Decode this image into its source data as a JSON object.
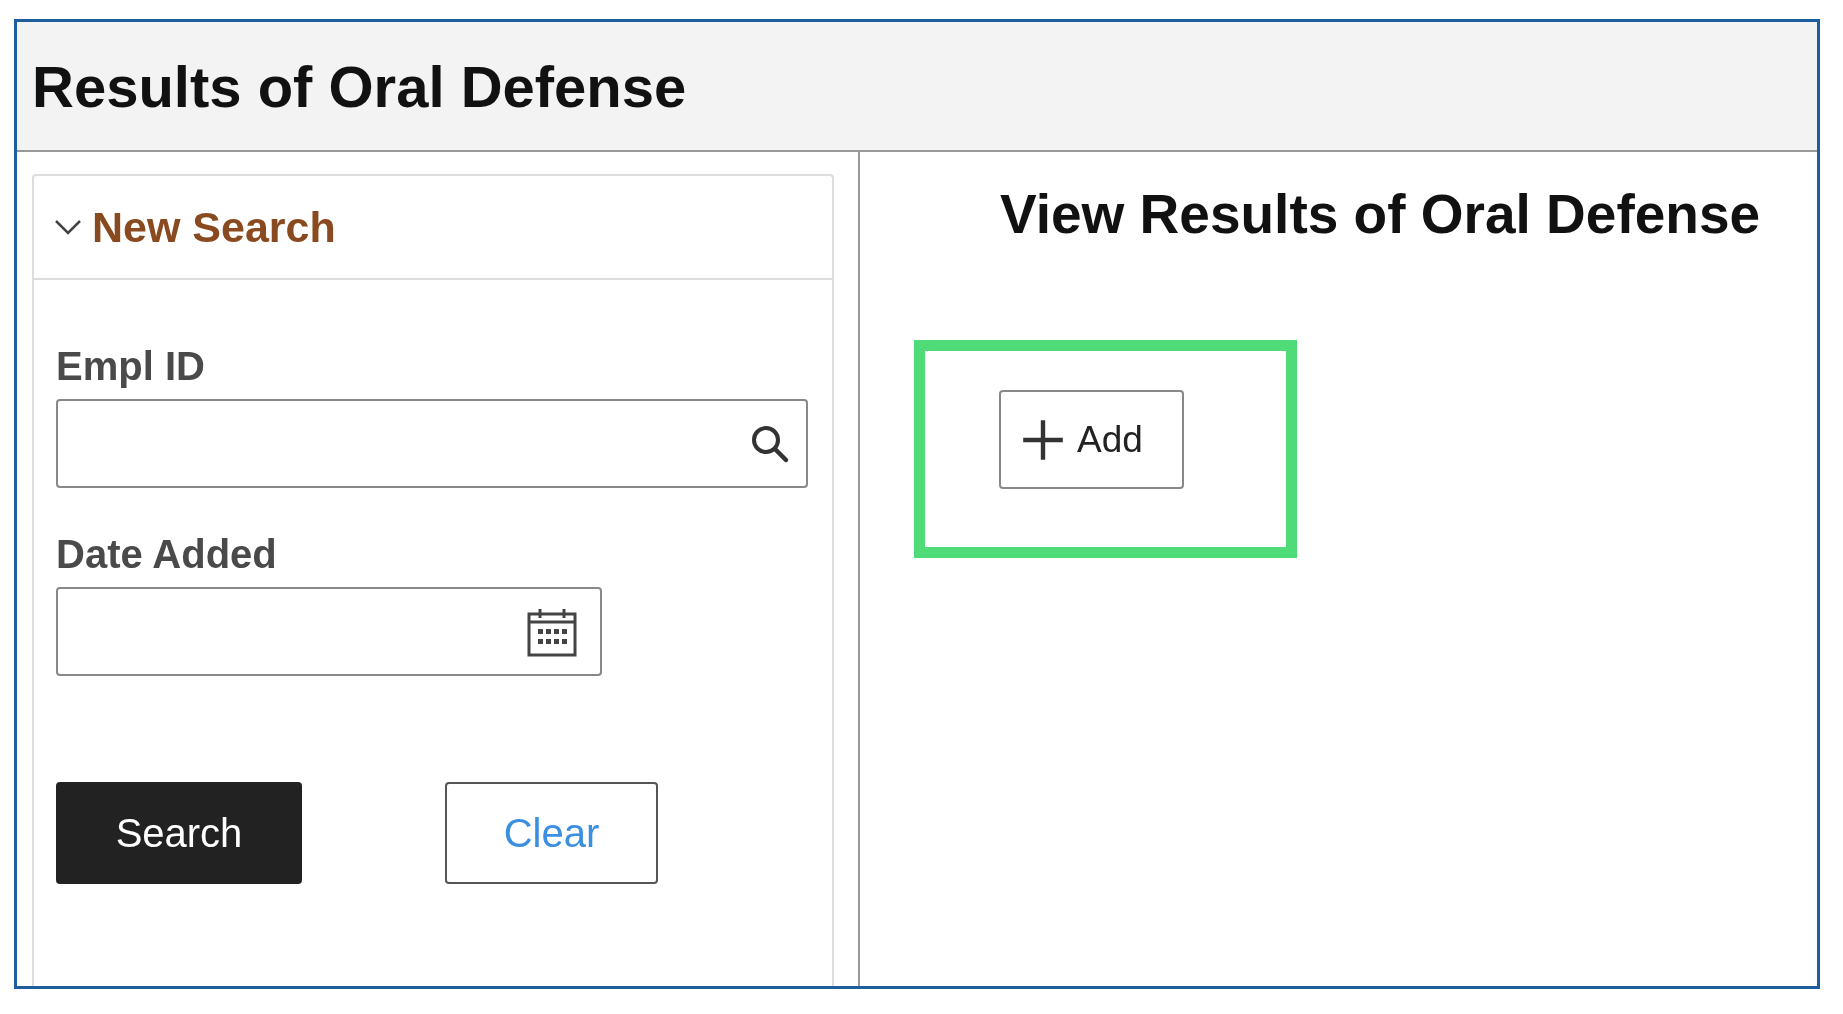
{
  "page": {
    "title": "Results of Oral Defense"
  },
  "search_panel": {
    "heading": "New Search",
    "expanded": true,
    "fields": [
      {
        "label": "Empl ID",
        "kind": "lookup"
      },
      {
        "label": "Date Added",
        "kind": "date"
      }
    ],
    "buttons": [
      {
        "label": "Search",
        "kind": "primary"
      },
      {
        "label": "Clear",
        "kind": "secondary"
      }
    ]
  },
  "main": {
    "title": "View Results of Oral Defense",
    "add_button": {
      "label": "Add",
      "highlighted": true
    }
  }
}
